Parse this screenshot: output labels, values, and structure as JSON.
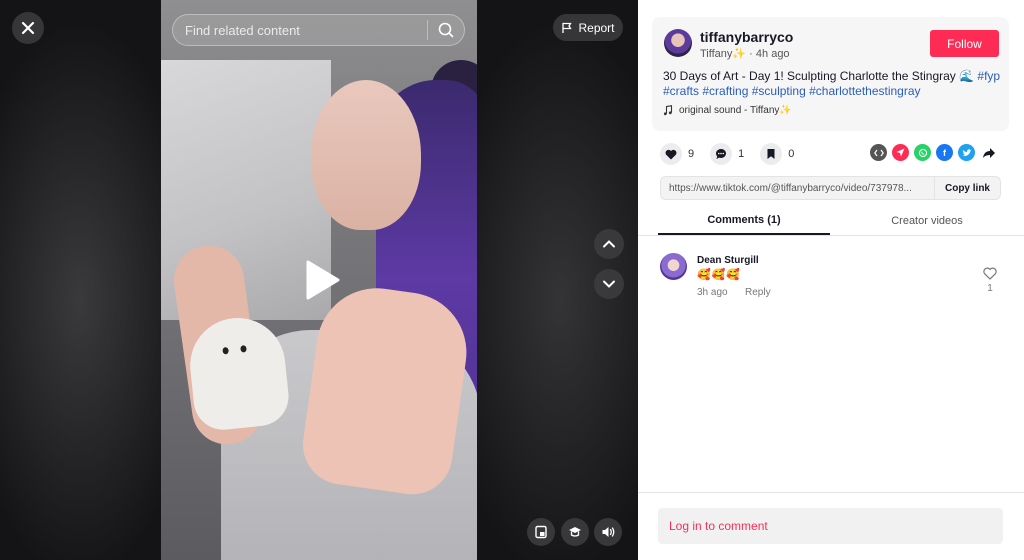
{
  "search": {
    "placeholder": "Find related content"
  },
  "report_label": "Report",
  "author": {
    "username": "tiffanybarryco",
    "display_name": "Tiffany✨",
    "time_ago": "4h ago",
    "follow_label": "Follow"
  },
  "caption": {
    "text": "30 Days of Art - Day 1! Sculpting Charlotte the Stingray 🌊 ",
    "hashtags": [
      "#fyp",
      "#crafts",
      "#crafting",
      "#sculpting",
      "#charlottethestingray"
    ]
  },
  "sound": "original sound - Tiffany✨",
  "stats": {
    "likes": "9",
    "comments": "1",
    "saves": "0"
  },
  "share_icons": [
    "embed-icon",
    "send-icon",
    "whatsapp-icon",
    "facebook-icon",
    "twitter-icon",
    "forward-icon"
  ],
  "link": {
    "url": "https://www.tiktok.com/@tiffanybarryco/video/737978...",
    "copy_label": "Copy link"
  },
  "tabs": [
    {
      "label": "Comments (1)",
      "active": true
    },
    {
      "label": "Creator videos",
      "active": false
    }
  ],
  "comments": [
    {
      "name": "Dean Sturgill",
      "text": "🥰🥰🥰",
      "time": "3h ago",
      "reply_label": "Reply",
      "likes": "1"
    }
  ],
  "login_label": "Log in to comment",
  "colors": {
    "accent": "#fe2c55",
    "hashtag": "#2b5db9"
  }
}
